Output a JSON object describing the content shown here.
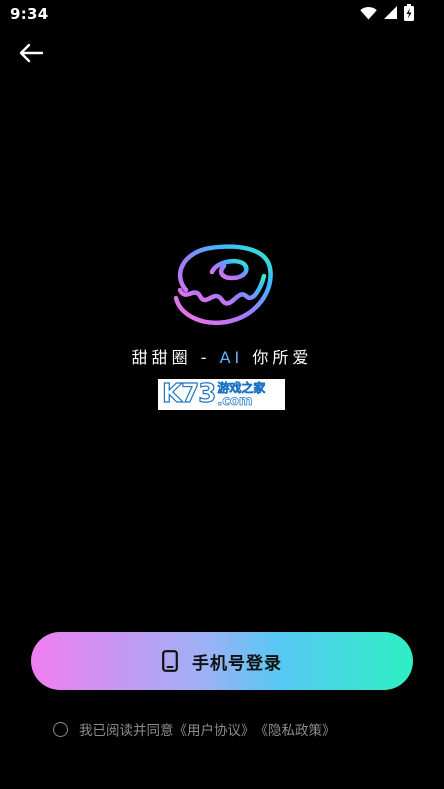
{
  "status_bar": {
    "time": "9:34"
  },
  "header": {
    "back_icon": "arrow-left-icon"
  },
  "brand": {
    "logo_icon": "donut-logo-icon",
    "slogan_prefix": "甜甜圈 - ",
    "slogan_ai": "AI",
    "slogan_suffix": " 你所爱"
  },
  "watermark": {
    "k73": "K73",
    "site": "游戏之家",
    "dotcom": ".com"
  },
  "login": {
    "label": "手机号登录",
    "icon": "phone-icon"
  },
  "agreement": {
    "text": "我已阅读并同意",
    "user_agreement": "《用户协议》",
    "privacy_policy": "《隐私政策》"
  },
  "colors": {
    "background": "#000000",
    "button_gradient_start": "#f07ef0",
    "button_gradient_end": "#2ef0c2",
    "muted_text": "#8c8c8c"
  }
}
